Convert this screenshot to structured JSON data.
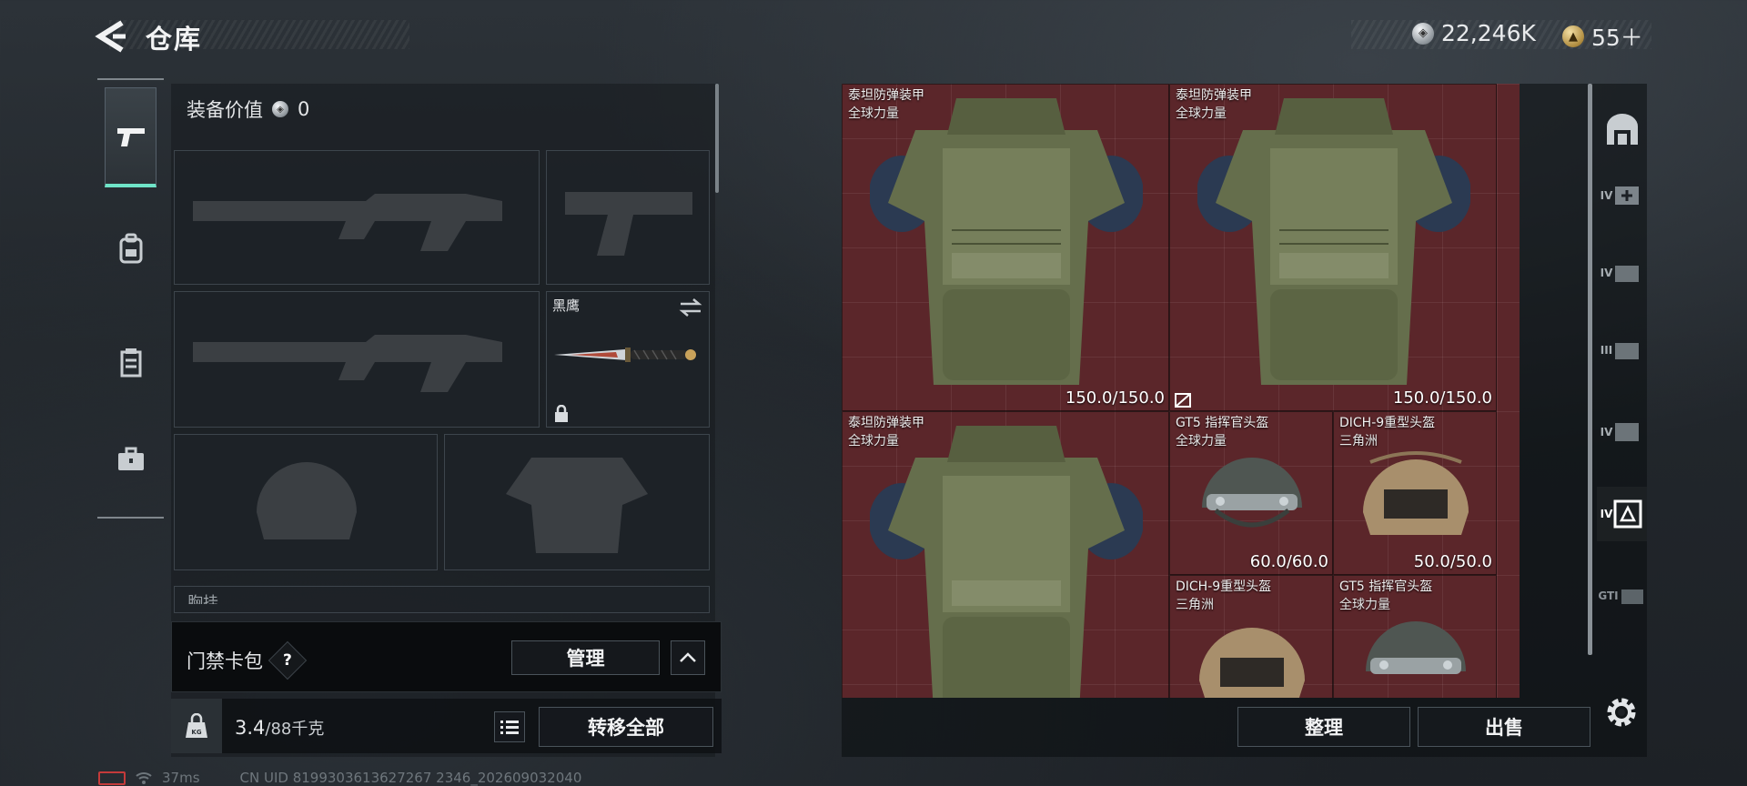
{
  "header": {
    "title": "仓库",
    "currency_silver": "22,246K",
    "currency_gold": "55＋"
  },
  "left_tabs": [
    "pistol-icon",
    "backpack-icon",
    "chest-rig-icon",
    "briefcase-icon"
  ],
  "equipment": {
    "value_label": "装备价值",
    "value": "0",
    "knife_name": "黑鹰",
    "chest_label": "胸挂 ",
    "card_bag_label": "门禁卡包",
    "help_symbol": "?",
    "manage_label": "管理",
    "weight_value": "3.4",
    "weight_unit": "/88千克",
    "kg_label": "KG",
    "transfer_label": "转移全部"
  },
  "inventory": {
    "items": [
      {
        "name": "泰坦防弹装甲",
        "sub": "全球力量",
        "durability": "150.0/150.0"
      },
      {
        "name": "泰坦防弹装甲",
        "sub": "全球力量",
        "durability": "150.0/150.0"
      },
      {
        "name": "泰坦防弹装甲",
        "sub": "全球力量",
        "durability": ""
      },
      {
        "name": "GT5 指挥官头盔",
        "sub": "全球力量",
        "durability": "60.0/60.0"
      },
      {
        "name": "DICH-9重型头盔",
        "sub": "三角洲",
        "durability": "50.0/50.0"
      },
      {
        "name": "DICH-9重型头盔",
        "sub": "三角洲",
        "durability": ""
      },
      {
        "name": "GT5 指挥官头盔",
        "sub": "全球力量",
        "durability": ""
      }
    ],
    "sort_label": "整理",
    "sell_label": "出售",
    "category_labels": [
      "IV",
      "IV",
      "III",
      "IV",
      "IV",
      "GTI"
    ]
  },
  "status": {
    "ping": "37ms",
    "uid": "CN UID 8199303613627267 2346_202609032040"
  },
  "colors": {
    "accent": "#6fe4c8",
    "grid_bg": "#5b262a",
    "battery": "#c43a3a"
  }
}
